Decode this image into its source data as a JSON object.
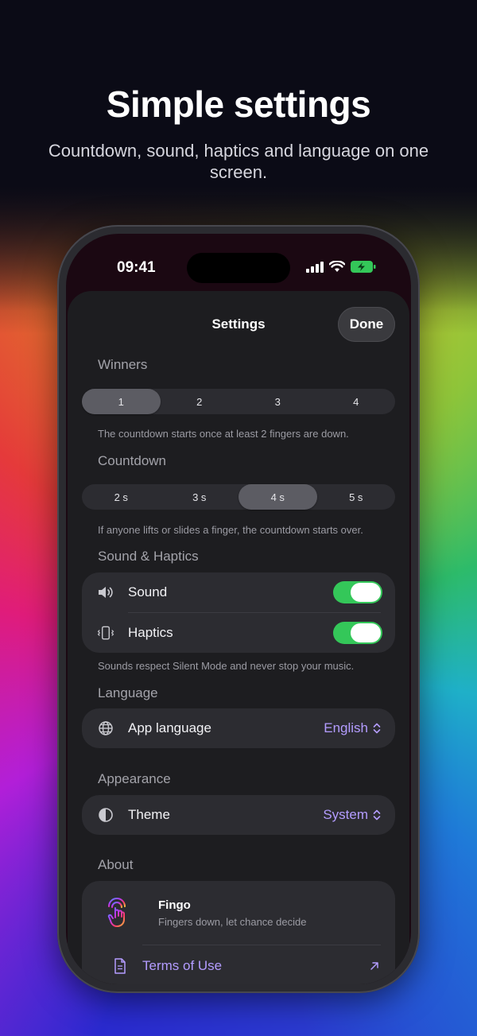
{
  "hero": {
    "title": "Simple settings",
    "subtitle": "Countdown, sound, haptics and language on one screen."
  },
  "statusbar": {
    "time": "09:41"
  },
  "sheet": {
    "title": "Settings",
    "done_label": "Done"
  },
  "winners": {
    "label": "Winners",
    "options": [
      "1",
      "2",
      "3",
      "4"
    ],
    "selected": "1",
    "hint": "The countdown starts once at least 2 fingers are down."
  },
  "countdown": {
    "label": "Countdown",
    "options": [
      "2 s",
      "3 s",
      "4 s",
      "5 s"
    ],
    "selected": "4 s",
    "hint": "If anyone lifts or slides a finger, the countdown starts over."
  },
  "sound_haptics": {
    "label": "Sound & Haptics",
    "sound_label": "Sound",
    "sound_on": true,
    "haptics_label": "Haptics",
    "haptics_on": true,
    "hint": "Sounds respect Silent Mode and never stop your music."
  },
  "language": {
    "label": "Language",
    "row_label": "App language",
    "value": "English"
  },
  "appearance": {
    "label": "Appearance",
    "row_label": "Theme",
    "value": "System"
  },
  "about": {
    "label": "About",
    "app_name": "Fingo",
    "app_tagline": "Fingers down, let chance decide",
    "terms_label": "Terms of Use"
  },
  "colors": {
    "accent": "#b39cff",
    "toggle_on": "#34c759",
    "battery": "#34c759"
  },
  "icons": {
    "sound": "speaker-icon",
    "haptics": "vibrate-icon",
    "language": "globe-icon",
    "theme": "half-circle-icon",
    "terms": "document-icon",
    "external": "arrow-up-right-icon",
    "updown": "chevron-updown-icon"
  }
}
